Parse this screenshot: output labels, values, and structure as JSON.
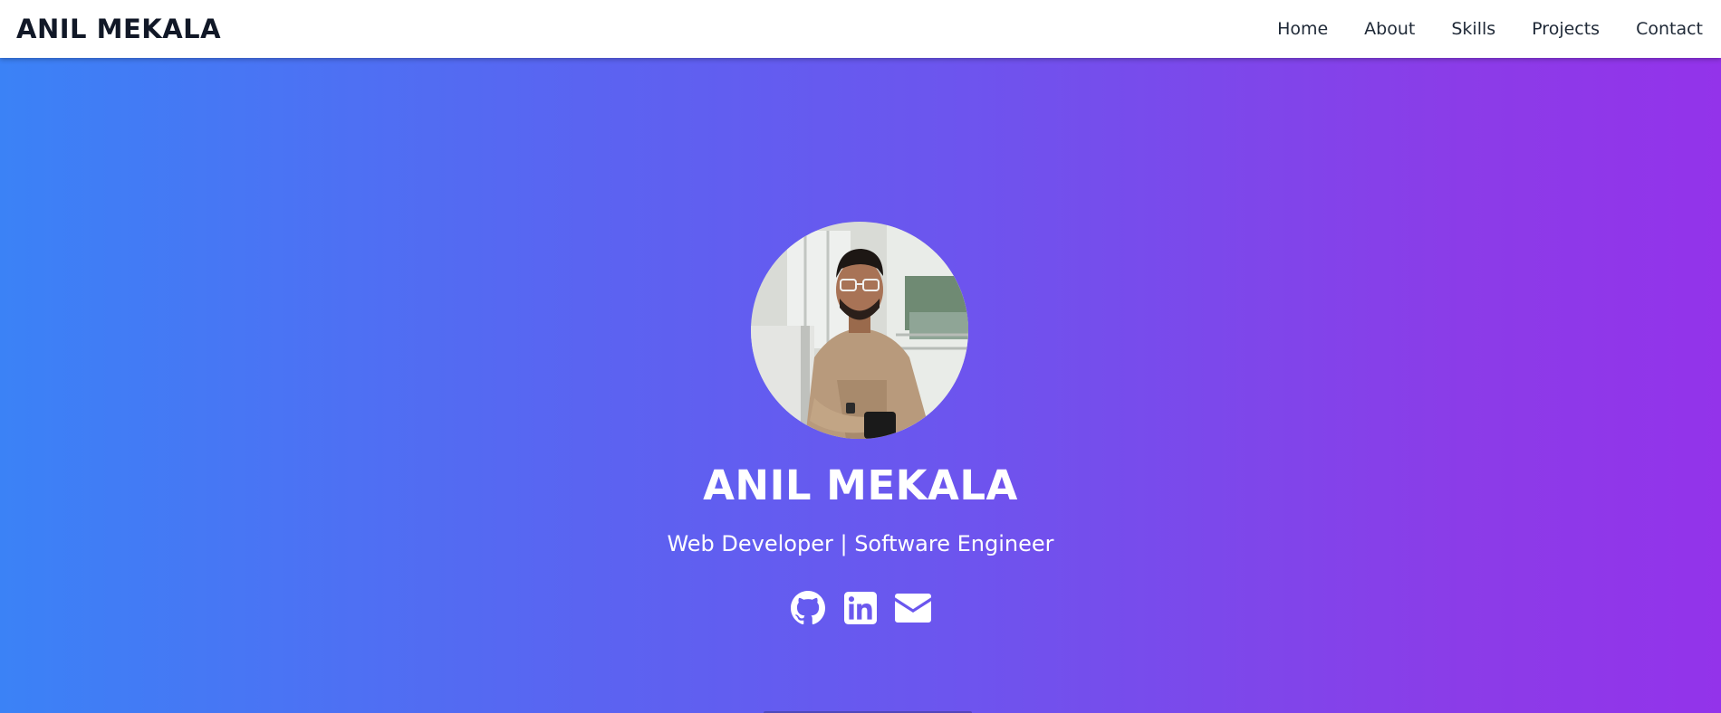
{
  "header": {
    "brand": "ANIL MEKALA",
    "nav": [
      {
        "label": "Home"
      },
      {
        "label": "About"
      },
      {
        "label": "Skills"
      },
      {
        "label": "Projects"
      },
      {
        "label": "Contact"
      }
    ]
  },
  "hero": {
    "name": "ANIL MEKALA",
    "role": "Web Developer | Software Engineer",
    "gradient": {
      "start": "#3b82f6",
      "end": "#9333ea"
    },
    "socials": [
      {
        "icon": "github-icon"
      },
      {
        "icon": "linkedin-icon"
      },
      {
        "icon": "envelope-icon"
      }
    ]
  }
}
